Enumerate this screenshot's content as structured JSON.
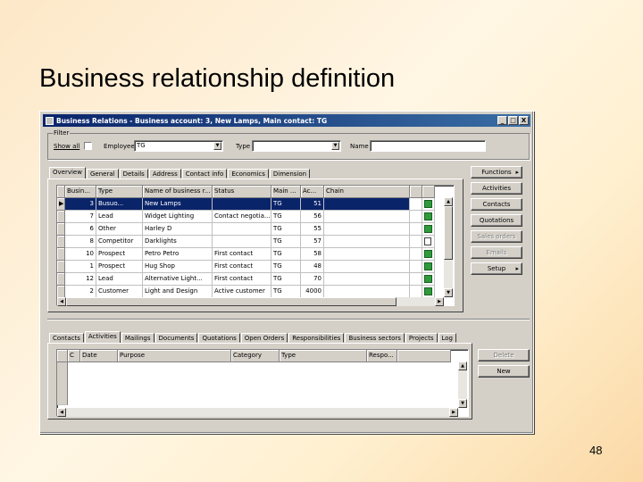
{
  "slide": {
    "title": "Business relationship definition",
    "page_number": "48"
  },
  "window": {
    "title": "Business Relations - Business account: 3, New Lamps, Main contact: TG",
    "minimize": "_",
    "maximize": "□",
    "close": "X"
  },
  "filter": {
    "group_label": "Filter",
    "show_all_label": "Show all",
    "employee_label": "Employee",
    "employee_value": "TG",
    "type_label": "Type",
    "type_value": "",
    "name_label": "Name",
    "name_value": ""
  },
  "top_tabs": [
    "Overview",
    "General",
    "Details",
    "Address",
    "Contact info",
    "Economics",
    "Dimension"
  ],
  "grid": {
    "columns": [
      "Busin...",
      "Type",
      "Name of business r...",
      "Status",
      "Main ...",
      "Ac...",
      "Chain"
    ],
    "rows": [
      {
        "busin": "3",
        "type": "Busuo...",
        "name": "New Lamps",
        "status": "",
        "main": "TG",
        "ac": "51",
        "chain": "",
        "icon": "green"
      },
      {
        "busin": "7",
        "type": "Lead",
        "name": "Widget Lighting",
        "status": "Contact negotia...",
        "main": "TG",
        "ac": "56",
        "chain": "",
        "icon": "green"
      },
      {
        "busin": "6",
        "type": "Other",
        "name": "Harley D",
        "status": "",
        "main": "TG",
        "ac": "55",
        "chain": "",
        "icon": "green"
      },
      {
        "busin": "8",
        "type": "Competitor",
        "name": "Darklights",
        "status": "",
        "main": "TG",
        "ac": "57",
        "chain": "",
        "icon": "white"
      },
      {
        "busin": "10",
        "type": "Prospect",
        "name": "Petro Petro",
        "status": "First contact",
        "main": "TG",
        "ac": "58",
        "chain": "",
        "icon": "green"
      },
      {
        "busin": "1",
        "type": "Prospect",
        "name": "Hug Shop",
        "status": "First contact",
        "main": "TG",
        "ac": "48",
        "chain": "",
        "icon": "green"
      },
      {
        "busin": "12",
        "type": "Lead",
        "name": "Alternative Light...",
        "status": "First contact",
        "main": "TG",
        "ac": "70",
        "chain": "",
        "icon": "green"
      },
      {
        "busin": "2",
        "type": "Customer",
        "name": "Light and Design",
        "status": "Active customer",
        "main": "TG",
        "ac": "4000",
        "chain": "",
        "icon": "green"
      }
    ]
  },
  "right_buttons": [
    {
      "label": "Functions",
      "arrow": "▸",
      "disabled": false
    },
    {
      "label": "Activities",
      "arrow": "",
      "disabled": false
    },
    {
      "label": "Contacts",
      "arrow": "",
      "disabled": false
    },
    {
      "label": "Quotations",
      "arrow": "",
      "disabled": false
    },
    {
      "label": "Sales orders",
      "arrow": "",
      "disabled": true
    },
    {
      "label": "Emails",
      "arrow": "",
      "disabled": true
    },
    {
      "label": "Setup",
      "arrow": "▸",
      "disabled": false
    }
  ],
  "bottom_tabs": [
    "Contacts",
    "Activities",
    "Mailings",
    "Documents",
    "Quotations",
    "Open Orders",
    "Responsibilities",
    "Business sectors",
    "Projects",
    "Log"
  ],
  "bottom_grid": {
    "columns": [
      "C",
      "Date",
      "Purpose",
      "Category",
      "Type",
      "Respo..."
    ]
  },
  "bottom_buttons": [
    {
      "label": "Delete",
      "disabled": true
    },
    {
      "label": "New",
      "disabled": false
    }
  ],
  "colors": {
    "selection": "#0a246a",
    "titlebar": "#0a246a",
    "status_icon": "#2e9b3a"
  }
}
